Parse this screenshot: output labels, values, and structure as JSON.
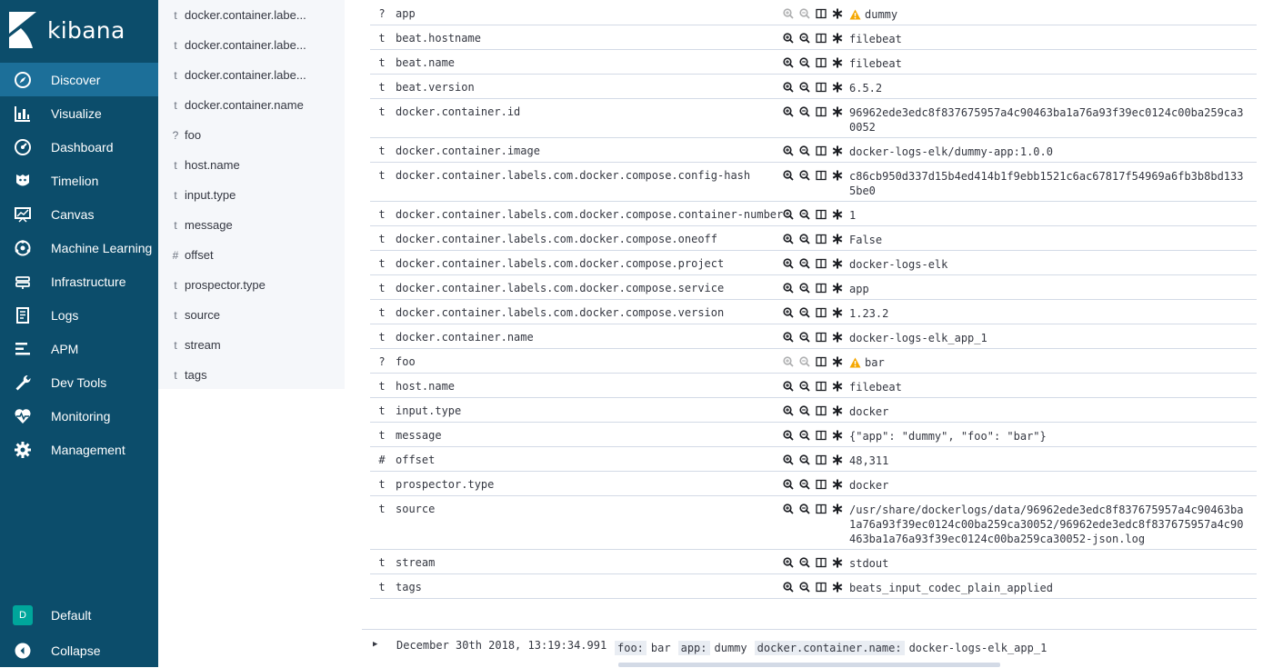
{
  "app": {
    "name": "kibana"
  },
  "nav": {
    "items": [
      {
        "label": "Discover",
        "icon": "compass-icon"
      },
      {
        "label": "Visualize",
        "icon": "bar-chart-icon"
      },
      {
        "label": "Dashboard",
        "icon": "gauge-icon"
      },
      {
        "label": "Timelion",
        "icon": "timelion-icon"
      },
      {
        "label": "Canvas",
        "icon": "canvas-icon"
      },
      {
        "label": "Machine Learning",
        "icon": "machine-learning-icon"
      },
      {
        "label": "Infrastructure",
        "icon": "infrastructure-icon"
      },
      {
        "label": "Logs",
        "icon": "logs-icon"
      },
      {
        "label": "APM",
        "icon": "apm-icon"
      },
      {
        "label": "Dev Tools",
        "icon": "wrench-icon"
      },
      {
        "label": "Monitoring",
        "icon": "heartbeat-icon"
      },
      {
        "label": "Management",
        "icon": "gear-icon"
      }
    ],
    "space": {
      "badge": "D",
      "label": "Default"
    },
    "collapse": {
      "label": "Collapse"
    },
    "active_color": "#1c6f99",
    "background_color": "#0c4d6b"
  },
  "fields": [
    {
      "type": "t",
      "name": "docker.container.labe..."
    },
    {
      "type": "t",
      "name": "docker.container.labe..."
    },
    {
      "type": "t",
      "name": "docker.container.labe..."
    },
    {
      "type": "t",
      "name": "docker.container.name"
    },
    {
      "type": "?",
      "name": "foo"
    },
    {
      "type": "t",
      "name": "host.name"
    },
    {
      "type": "t",
      "name": "input.type"
    },
    {
      "type": "t",
      "name": "message"
    },
    {
      "type": "#",
      "name": "offset"
    },
    {
      "type": "t",
      "name": "prospector.type"
    },
    {
      "type": "t",
      "name": "source"
    },
    {
      "type": "t",
      "name": "stream"
    },
    {
      "type": "t",
      "name": "tags"
    }
  ],
  "document": {
    "rows": [
      {
        "type": "?",
        "name": "app",
        "value": "dummy",
        "warning": true
      },
      {
        "type": "t",
        "name": "beat.hostname",
        "value": "filebeat"
      },
      {
        "type": "t",
        "name": "beat.name",
        "value": "filebeat"
      },
      {
        "type": "t",
        "name": "beat.version",
        "value": "6.5.2"
      },
      {
        "type": "t",
        "name": "docker.container.id",
        "value": "96962ede3edc8f837675957a4c90463ba1a76a93f39ec0124c00ba259ca30052"
      },
      {
        "type": "t",
        "name": "docker.container.image",
        "value": "docker-logs-elk/dummy-app:1.0.0"
      },
      {
        "type": "t",
        "name": "docker.container.labels.com.docker.compose.config-hash",
        "value": "c86cb950d337d15b4ed414b1f9ebb1521c6ac67817f54969a6fb3b8bd1335be0"
      },
      {
        "type": "t",
        "name": "docker.container.labels.com.docker.compose.container-number",
        "value": "1"
      },
      {
        "type": "t",
        "name": "docker.container.labels.com.docker.compose.oneoff",
        "value": "False"
      },
      {
        "type": "t",
        "name": "docker.container.labels.com.docker.compose.project",
        "value": "docker-logs-elk"
      },
      {
        "type": "t",
        "name": "docker.container.labels.com.docker.compose.service",
        "value": "app"
      },
      {
        "type": "t",
        "name": "docker.container.labels.com.docker.compose.version",
        "value": "1.23.2"
      },
      {
        "type": "t",
        "name": "docker.container.name",
        "value": "docker-logs-elk_app_1"
      },
      {
        "type": "?",
        "name": "foo",
        "value": "bar",
        "warning": true
      },
      {
        "type": "t",
        "name": "host.name",
        "value": "filebeat"
      },
      {
        "type": "t",
        "name": "input.type",
        "value": "docker"
      },
      {
        "type": "t",
        "name": "message",
        "value": "{\"app\": \"dummy\", \"foo\": \"bar\"}"
      },
      {
        "type": "#",
        "name": "offset",
        "value": "48,311"
      },
      {
        "type": "t",
        "name": "prospector.type",
        "value": "docker"
      },
      {
        "type": "t",
        "name": "source",
        "value": "/usr/share/dockerlogs/data/96962ede3edc8f837675957a4c90463ba1a76a93f39ec0124c00ba259ca30052/96962ede3edc8f837675957a4c90463ba1a76a93f39ec0124c00ba259ca30052-json.log"
      },
      {
        "type": "t",
        "name": "stream",
        "value": "stdout"
      },
      {
        "type": "t",
        "name": "tags",
        "value": "beats_input_codec_plain_applied"
      }
    ]
  },
  "summary": {
    "timestamp": "December 30th 2018, 13:19:34.991",
    "source": [
      {
        "key": "foo:",
        "value": "bar"
      },
      {
        "key": "app:",
        "value": "dummy"
      },
      {
        "key": "docker.container.name:",
        "value": "docker-logs-elk_app_1"
      }
    ]
  },
  "colors": {
    "warning": "#f5a700",
    "border": "#d3dae6",
    "field_panel": "#f5f7fa"
  }
}
